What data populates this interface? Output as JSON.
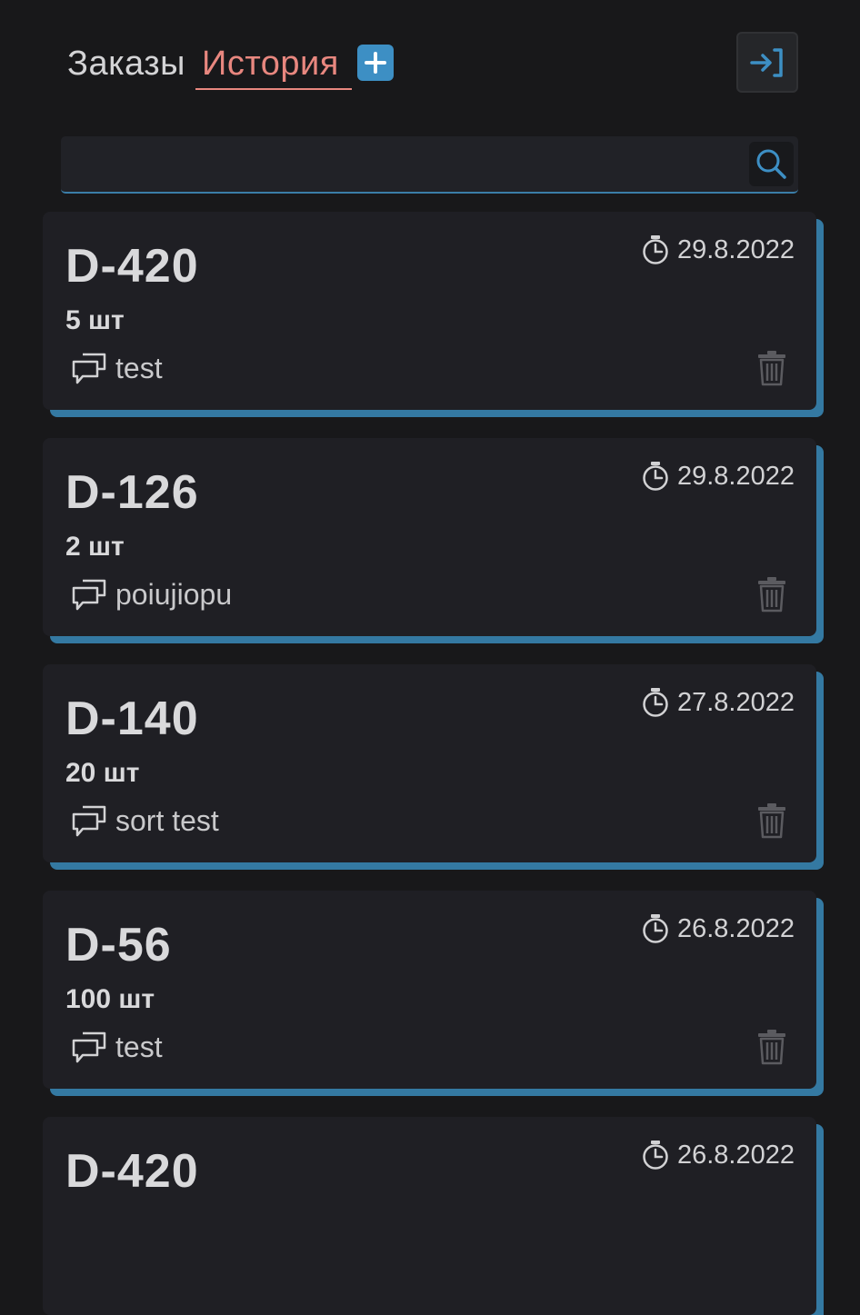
{
  "header": {
    "tab_orders": "Заказы",
    "tab_history": "История",
    "active_tab": "История"
  },
  "search": {
    "value": "",
    "placeholder": ""
  },
  "orders": [
    {
      "code": "D-420",
      "date": "29.8.2022",
      "qty": "5 шт",
      "comment": "test"
    },
    {
      "code": "D-126",
      "date": "29.8.2022",
      "qty": "2 шт",
      "comment": "poiujiopu"
    },
    {
      "code": "D-140",
      "date": "27.8.2022",
      "qty": "20 шт",
      "comment": "sort test"
    },
    {
      "code": "D-56",
      "date": "26.8.2022",
      "qty": "100 шт",
      "comment": "test"
    },
    {
      "code": "D-420",
      "date": "26.8.2022",
      "qty": "",
      "comment": ""
    }
  ],
  "colors": {
    "accent": "#3d8fc4",
    "active_tab": "#e8877f",
    "background": "#18181a",
    "card": "#1f1f24",
    "card_shadow": "#3479a2"
  },
  "icons": {
    "add": "plus-icon",
    "logout": "logout-icon",
    "search": "search-icon",
    "date": "stopwatch-icon",
    "comment": "chat-bubbles-icon",
    "delete": "trash-icon"
  }
}
